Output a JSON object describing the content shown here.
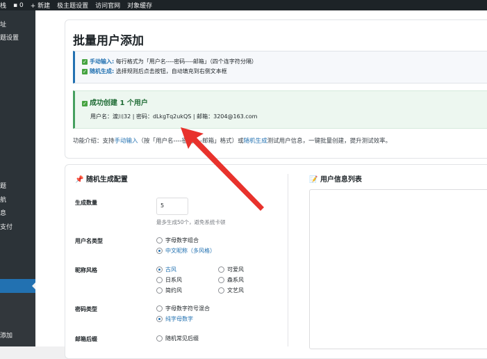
{
  "topbar": {
    "site": "栈",
    "comments": "0",
    "new": "+ 新建",
    "theme_settings": "极主题设置",
    "visit": "访问官网",
    "cache": "对象缓存"
  },
  "sidebar": {
    "items": [
      "址",
      "题设置",
      "题",
      "航",
      "息",
      "支付",
      "添加"
    ]
  },
  "page": {
    "title": "批量用户添加"
  },
  "info": {
    "manual_label": "手动输入:",
    "manual_text": "每行格式为「用户名----密码----邮箱」（四个连字符分隔）",
    "random_label": "随机生成:",
    "random_text": "选择规则后点击按钮，自动填充到右侧文本框"
  },
  "success": {
    "title": "成功创建 1 个用户",
    "detail": "用户名：渡川32 | 密码：dLkgTq2ukQS | 邮箱：3204@163.com"
  },
  "intro": {
    "prefix": "功能介绍：支持",
    "manual": "手动输入",
    "mid": "（按「用户名----密码----邮箱」格式）或",
    "random": "随机生成",
    "suffix": "测试用户信息，一键批量创建，提升测试效率。"
  },
  "config": {
    "title": "随机生成配置",
    "count_label": "生成数量",
    "count_value": "5",
    "count_hint": "最多生成50个，避免系统卡顿",
    "username_label": "用户名类型",
    "username_opts": [
      "字母数字组合",
      "中文昵称（多风格）"
    ],
    "style_label": "昵称风格",
    "style_opts": [
      "古风",
      "可爱风",
      "日系风",
      "森系风",
      "简约风",
      "文艺风"
    ],
    "password_label": "密码类型",
    "password_opts": [
      "字母数字符号混合",
      "纯字母数字"
    ],
    "email_label": "邮箱后缀",
    "email_opts": [
      "随机常见后缀"
    ]
  },
  "list": {
    "title": "用户信息列表"
  },
  "colors": {
    "accent": "#2271b1",
    "arrow": "#e8322c"
  }
}
